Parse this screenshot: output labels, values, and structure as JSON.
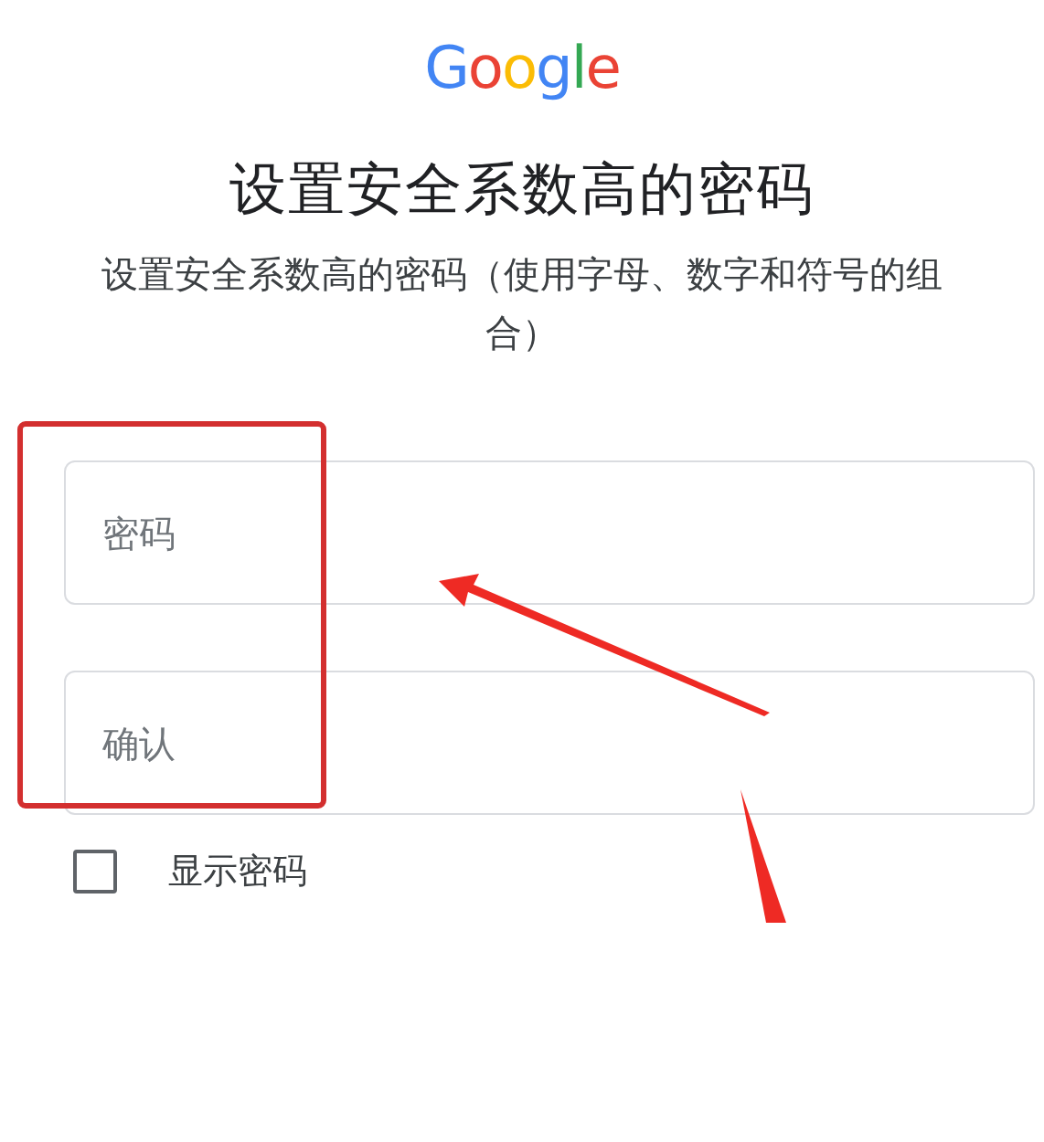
{
  "logo": "Google",
  "title": "设置安全系数高的密码",
  "subtitle": "设置安全系数高的密码（使用字母、数字和符号的组合）",
  "fields": [
    {
      "placeholder": "密码"
    },
    {
      "placeholder": "确认"
    }
  ],
  "show_password": {
    "label": "显示密码",
    "checked": false
  },
  "annotations": [
    {
      "kind": "box"
    },
    {
      "kind": "arrow"
    },
    {
      "kind": "wedge"
    }
  ]
}
